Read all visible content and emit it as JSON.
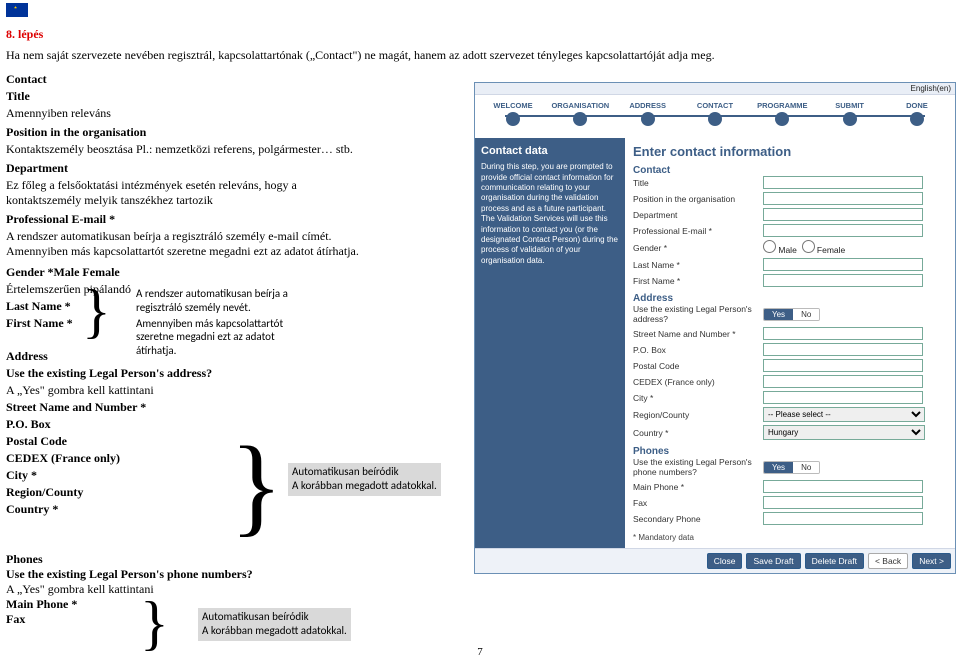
{
  "step": "8. lépés",
  "intro": "Ha nem saját szervezete nevében regisztrál, kapcsolattartónak („Contact\") ne magát, hanem az adott szervezet tényleges kapcsolattartóját adja meg.",
  "left": {
    "contact": "Contact",
    "title": "Title",
    "title_note": "Amennyiben releváns",
    "position": "Position in the organisation",
    "position_note": "Kontaktszemély beosztása Pl.: nemzetközi referens, polgármester… stb.",
    "department": "Department",
    "department_note": "Ez főleg a felsőoktatási intézmények esetén releváns, hogy a kontaktszemély melyik tanszékhez tartozik",
    "email": "Professional E-mail *",
    "email_note": "A rendszer automatikusan beírja a regisztráló személy e-mail címét. Amennyiben más kapcsolattartót szeretne megadni ezt az adatot átírhatja.",
    "gender": "Gender *Male  Female",
    "gender_note": "Értelemszerűen pipálandó",
    "last_name": "Last Name *",
    "first_name": "First Name *",
    "names_note1": "A rendszer automatikusan beírja a regisztráló személy nevét.",
    "names_note2": "Amennyiben más kapcsolattartót szeretne megadni ezt az adatot átírhatja.",
    "address": "Address",
    "use_addr": "Use the existing Legal Person's address?",
    "use_addr_note": "A „Yes\" gombra kell kattintani",
    "street": "Street Name and Number *",
    "pobox": "P.O. Box",
    "postal": "Postal Code",
    "cedex": "CEDEX (France only)",
    "city": "City *",
    "region": "Region/County",
    "country": "Country *",
    "auto1": "Automatikusan beíródik",
    "auto2": "A korábban megadott adatokkal.",
    "phones": "Phones",
    "use_phones": "Use the existing Legal Person's phone numbers?",
    "use_phones_note": "A „Yes\" gombra kell kattintani",
    "main_phone": "Main Phone *",
    "fax": "Fax"
  },
  "app": {
    "lang": "English(en)",
    "steps": [
      "WELCOME",
      "ORGANISATION",
      "ADDRESS",
      "CONTACT",
      "PROGRAMME",
      "SUBMIT",
      "DONE"
    ],
    "sidebar_title": "Contact data",
    "sidebar_text": "During this step, you are prompted to provide official contact information for communication relating to your organisation during the validation process and as a future participant. The Validation Services will use this information to contact you (or the designated Contact Person) during the process of validation of your organisation data.",
    "heading": "Enter contact information",
    "s_contact": "Contact",
    "l_title": "Title",
    "l_position": "Position in the organisation",
    "l_department": "Department",
    "l_email": "Professional E-mail *",
    "l_gender": "Gender *",
    "g_male": "Male",
    "g_female": "Female",
    "l_last": "Last Name *",
    "l_first": "First Name *",
    "s_address": "Address",
    "l_use_addr": "Use the existing Legal Person's address?",
    "yes": "Yes",
    "no": "No",
    "l_street": "Street Name and Number *",
    "l_pobox": "P.O. Box",
    "l_postal": "Postal Code",
    "l_cedex": "CEDEX (France only)",
    "l_city": "City *",
    "l_region": "Region/County",
    "opt_select": "-- Please select --",
    "l_country": "Country *",
    "opt_country": "Hungary",
    "s_phones": "Phones",
    "l_use_phones": "Use the existing Legal Person's phone numbers?",
    "l_main_phone": "Main Phone *",
    "l_fax": "Fax",
    "l_secondary": "Secondary Phone",
    "mandatory": "* Mandatory data",
    "b_close": "Close",
    "b_save": "Save Draft",
    "b_delete": "Delete Draft",
    "b_back": "< Back",
    "b_next": "Next >"
  },
  "page_num": "7"
}
